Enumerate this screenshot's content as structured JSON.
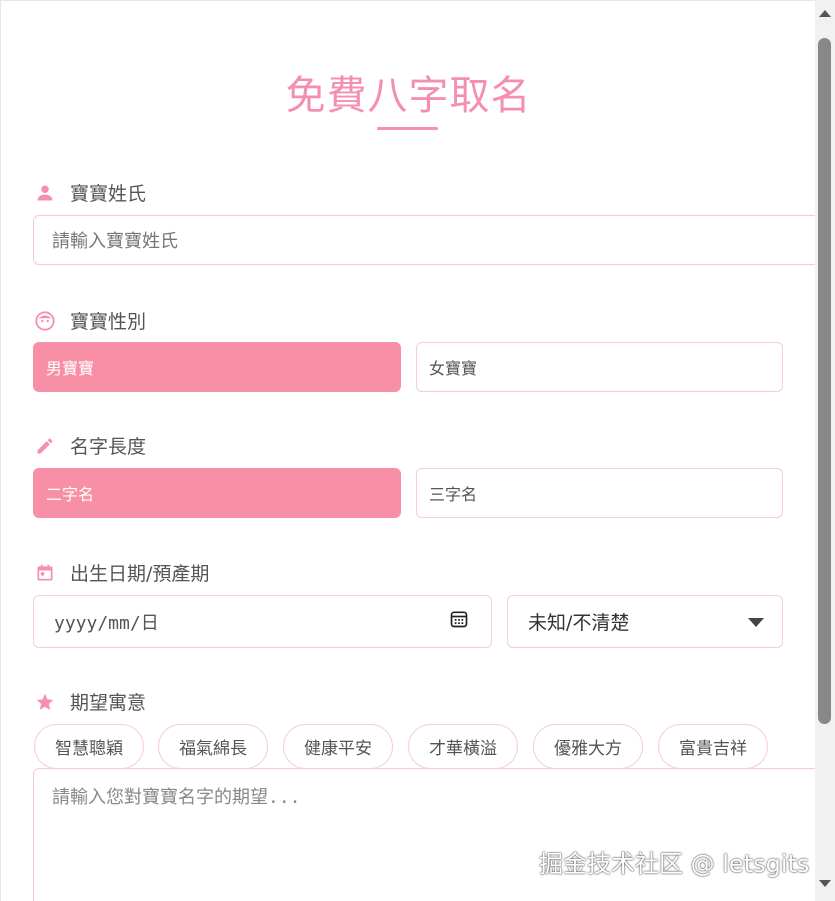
{
  "title": "免費八字取名",
  "surname": {
    "label": "寶寶姓氏",
    "icon": "person-icon",
    "placeholder": "請輸入寶寶姓氏"
  },
  "gender": {
    "label": "寶寶性別",
    "icon": "baby-face-icon",
    "options": [
      "男寶寶",
      "女寶寶"
    ],
    "selected": "男寶寶"
  },
  "name_length": {
    "label": "名字長度",
    "icon": "pencil-icon",
    "options": [
      "二字名",
      "三字名"
    ],
    "selected": "二字名"
  },
  "birth": {
    "label": "出生日期/預產期",
    "icon": "calendar-icon",
    "date_placeholder": "yyyy/mm/日",
    "time_select_value": "未知/不清楚"
  },
  "meaning": {
    "label": "期望寓意",
    "icon": "star-icon",
    "chips": [
      "智慧聰穎",
      "福氣綿長",
      "健康平安",
      "才華橫溢",
      "優雅大方",
      "富貴吉祥"
    ],
    "placeholder": "請輸入您對寶寶名字的期望..."
  },
  "watermark": "掘金技术社区 @ letsgits",
  "colors": {
    "accent": "#f48fb1",
    "active_button": "#f78fa7",
    "border": "#f3cdd9"
  }
}
